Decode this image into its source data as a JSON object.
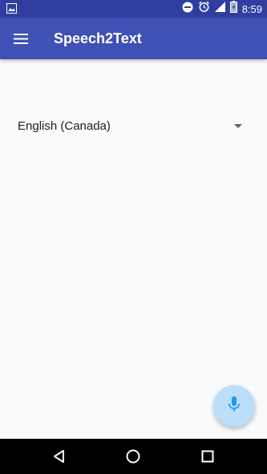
{
  "status_bar": {
    "time": "8:59",
    "icons": [
      "image-notification-icon",
      "do-not-disturb-icon",
      "alarm-icon",
      "signal-icon",
      "battery-charging-icon"
    ]
  },
  "app_bar": {
    "title": "Speech2Text",
    "menu_icon": "hamburger-menu-icon"
  },
  "language_spinner": {
    "selected": "English (Canada)"
  },
  "fab": {
    "icon": "microphone-icon"
  },
  "colors": {
    "status_bar": "#303f9f",
    "app_bar": "#3f51b5",
    "background": "#fafafa",
    "fab": "#bbdefb",
    "fab_icon": "#2196f3"
  }
}
